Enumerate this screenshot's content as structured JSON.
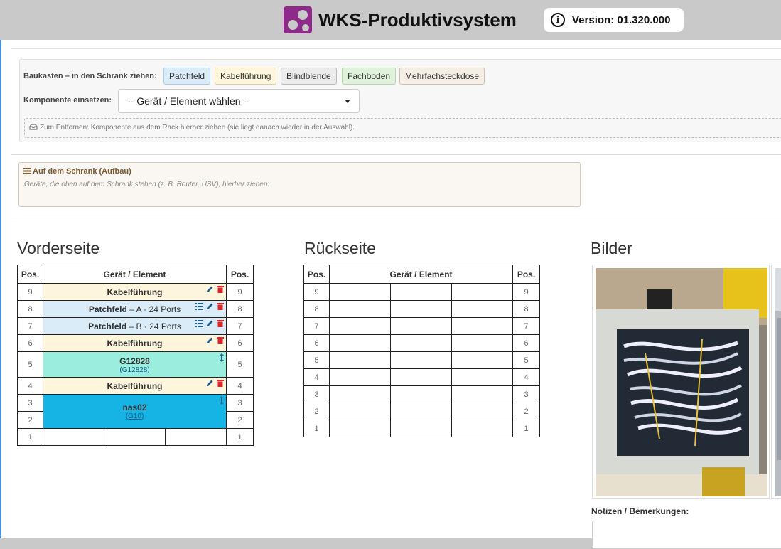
{
  "header": {
    "title": "WKS-Produktivsystem",
    "version_label": "Version: 01.320.000",
    "info_icon": "info-circle-icon",
    "logo_icon": "wks-logo-icon",
    "brand_color": "#8e2a8a"
  },
  "toolbox": {
    "baukasten_label": "Baukasten – in den Schrank ziehen:",
    "chips": [
      {
        "label": "Patchfeld",
        "bg": "#d9ecf7"
      },
      {
        "label": "Kabelführung",
        "bg": "#fdf6dc"
      },
      {
        "label": "Blindblende",
        "bg": "#ececec"
      },
      {
        "label": "Fachboden",
        "bg": "#e0f2dc"
      },
      {
        "label": "Mehrfachsteckdose",
        "bg": "#f4eee4"
      }
    ],
    "component_label": "Komponente einsetzen:",
    "select_value": "-- Gerät / Element wählen --",
    "remove_hint": "Zum Entfernen: Komponente aus dem Rack hierher ziehen (sie liegt danach wieder in der Auswahl)."
  },
  "on_top": {
    "title": "Auf dem Schrank (Aufbau)",
    "desc": "Geräte, die oben auf dem Schrank stehen (z. B. Router, USV), hierher ziehen."
  },
  "front": {
    "heading": "Vorderseite",
    "col_pos": "Pos.",
    "col_device": "Gerät / Element",
    "rows": [
      {
        "pos": "9",
        "name": "Kabelführung",
        "sub": "",
        "color": "#fdf6dc"
      },
      {
        "pos": "8",
        "name": "Patchfeld",
        "sub": " – A · 24 Ports",
        "color": "#d9ecf7"
      },
      {
        "pos": "7",
        "name": "Patchfeld",
        "sub": " – B · 24 Ports",
        "color": "#d9ecf7"
      },
      {
        "pos": "6",
        "name": "Kabelführung",
        "sub": "",
        "color": "#fdf6dc"
      },
      {
        "pos": "5",
        "name": "G12828",
        "link": "(G12828)",
        "color": "#9aeedd"
      },
      {
        "pos": "4",
        "name": "Kabelführung",
        "sub": "",
        "color": "#fdf6dc"
      },
      {
        "pos": "3",
        "name": "nas02",
        "link": "(G10)",
        "color": "#16b4e4"
      },
      {
        "pos": "2"
      },
      {
        "pos": "1"
      }
    ]
  },
  "back": {
    "heading": "Rückseite",
    "col_pos": "Pos.",
    "col_device": "Gerät / Element",
    "rows": [
      "9",
      "8",
      "7",
      "6",
      "5",
      "4",
      "3",
      "2",
      "1"
    ]
  },
  "images": {
    "heading": "Bilder",
    "notes_label": "Notizen / Bemerkungen:"
  }
}
